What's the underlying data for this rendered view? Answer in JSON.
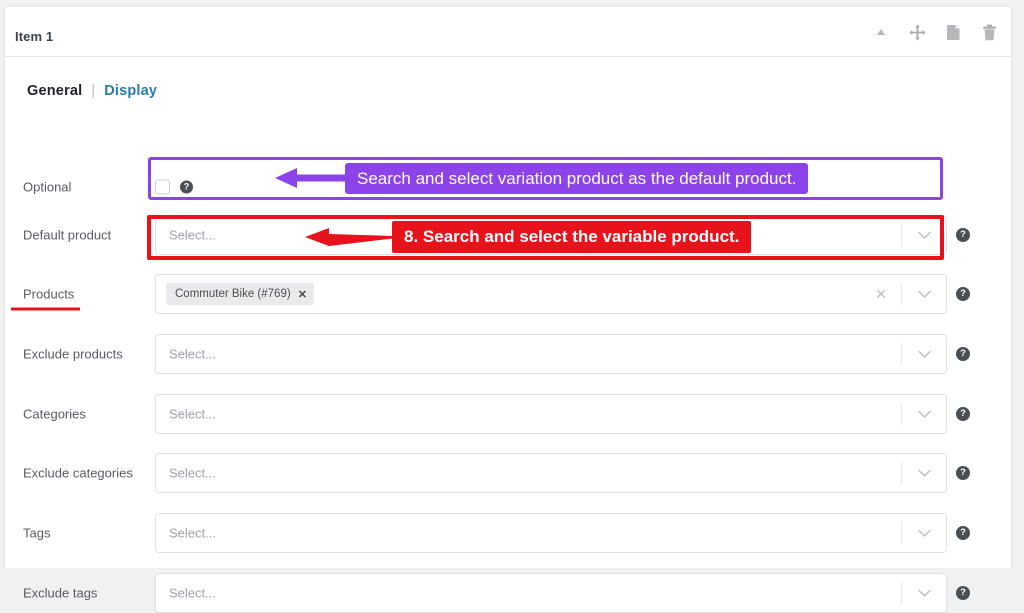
{
  "panel": {
    "title": "Item 1",
    "tools": [
      {
        "name": "collapse-icon",
        "label": "Collapse"
      },
      {
        "name": "move-icon",
        "label": "Move"
      },
      {
        "name": "duplicate-icon",
        "label": "Duplicate"
      },
      {
        "name": "delete-icon",
        "label": "Delete"
      }
    ]
  },
  "tabs": {
    "general": "General",
    "separator": "|",
    "display": "Display"
  },
  "rows": [
    {
      "label": "Optional",
      "type": "checkbox",
      "checked": false,
      "help": "?"
    },
    {
      "label": "Default product",
      "type": "select",
      "placeholder": "Select...",
      "help": "?",
      "has_clear": false,
      "chevron": "chevron-down"
    },
    {
      "label": "Products",
      "type": "multiselect",
      "placeholder": "",
      "token": "Commuter Bike (#769)",
      "token_remove": "✕",
      "clear": "✕",
      "help": "?",
      "has_clear": true,
      "chevron": "chevron-down",
      "underlined": true
    },
    {
      "label": "Exclude products",
      "type": "select",
      "placeholder": "Select...",
      "help": "?",
      "has_clear": false,
      "chevron": "chevron-down"
    },
    {
      "label": "Categories",
      "type": "select",
      "placeholder": "Select...",
      "help": "?",
      "has_clear": false,
      "chevron": "chevron-down"
    },
    {
      "label": "Exclude categories",
      "type": "select",
      "placeholder": "Select...",
      "help": "?",
      "has_clear": false,
      "chevron": "chevron-down"
    },
    {
      "label": "Tags",
      "type": "select",
      "placeholder": "Select...",
      "help": "?",
      "has_clear": false,
      "chevron": "chevron-down"
    },
    {
      "label": "Exclude tags",
      "type": "select",
      "placeholder": "Select...",
      "help": "?",
      "has_clear": false,
      "chevron": "chevron-down"
    }
  ],
  "annotations": [
    {
      "id": "default-product",
      "color": "#8d43ea",
      "text": "Search and select variation product as the default product."
    },
    {
      "id": "products",
      "color": "#e8121a",
      "text": "8. Search and select the variable product."
    }
  ],
  "colors": {
    "purple": "#8d43ea",
    "red": "#e8121a",
    "link_blue": "#2a7ab0",
    "label_gray": "#585c60",
    "placeholder_gray": "#9ea3a8"
  }
}
